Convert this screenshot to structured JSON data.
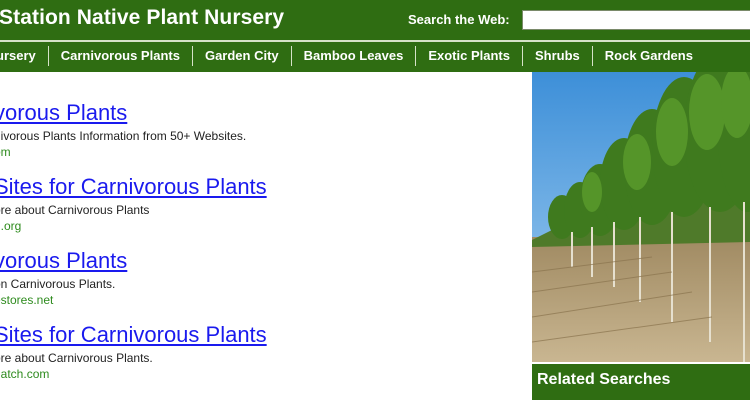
{
  "header": {
    "site_title": "Station Native Plant Nursery",
    "search_label": "Search the Web:",
    "search_value": ""
  },
  "nav": {
    "items": [
      "ursery",
      "Carnivorous Plants",
      "Garden City",
      "Bamboo Leaves",
      "Exotic Plants",
      "Shrubs",
      "Rock Gardens"
    ]
  },
  "results": [
    {
      "title": "vorous Plants",
      "desc": "nivorous Plants Information from 50+ Websites.",
      "url": "om"
    },
    {
      "title": "Sites for Carnivorous Plants",
      "desc": "ore about Carnivorous Plants",
      "url": "h.org"
    },
    {
      "title": "vorous Plants",
      "desc": "on Carnivorous Plants.",
      "url": "estores.net"
    },
    {
      "title": "Sites for Carnivorous Plants",
      "desc": "ore about Carnivorous Plants.",
      "url": "natch.com"
    }
  ],
  "sidebar": {
    "related_title": "Related Searches"
  },
  "colors": {
    "brand_green": "#2f6d12",
    "link_blue": "#1a1aee",
    "url_green": "#2e8b1e"
  }
}
